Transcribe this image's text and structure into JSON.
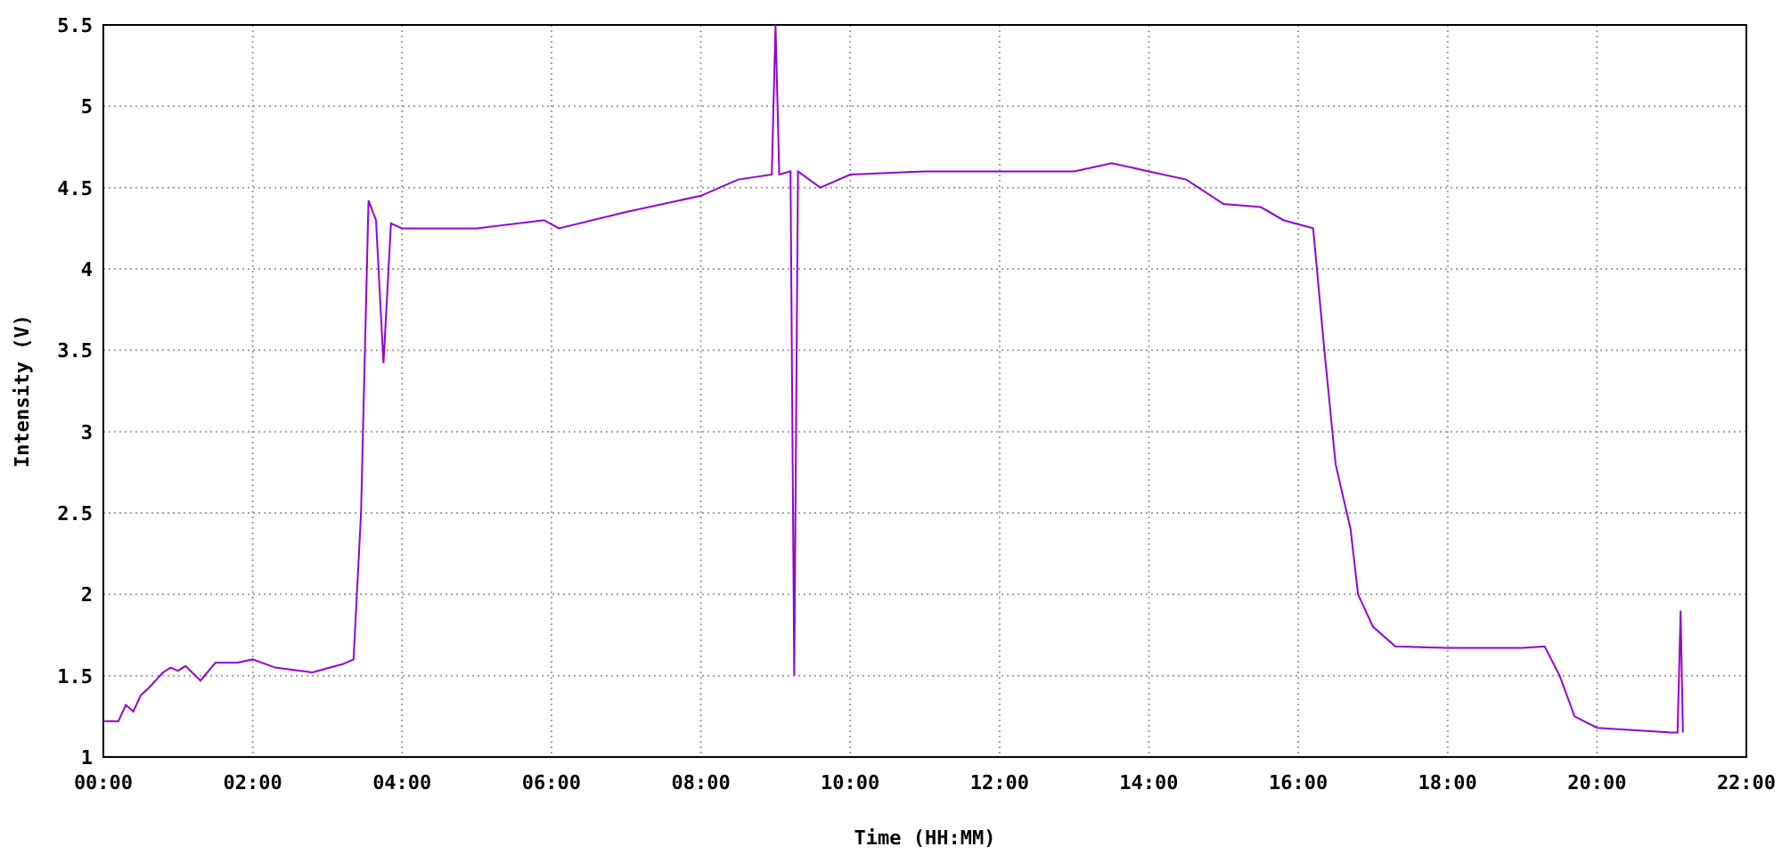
{
  "chart_data": {
    "type": "line",
    "grid": true,
    "xlabel": "Time (HH:MM)",
    "ylabel": "Intensity (V)",
    "xlim": [
      0,
      22
    ],
    "ylim": [
      1,
      5.5
    ],
    "xticks": [
      {
        "value": 0,
        "label": "00:00"
      },
      {
        "value": 2,
        "label": "02:00"
      },
      {
        "value": 4,
        "label": "04:00"
      },
      {
        "value": 6,
        "label": "06:00"
      },
      {
        "value": 8,
        "label": "08:00"
      },
      {
        "value": 10,
        "label": "10:00"
      },
      {
        "value": 12,
        "label": "12:00"
      },
      {
        "value": 14,
        "label": "14:00"
      },
      {
        "value": 16,
        "label": "16:00"
      },
      {
        "value": 18,
        "label": "18:00"
      },
      {
        "value": 20,
        "label": "20:00"
      },
      {
        "value": 22,
        "label": "22:00"
      }
    ],
    "yticks": [
      1,
      1.5,
      2,
      2.5,
      3,
      3.5,
      4,
      4.5,
      5,
      5.5
    ],
    "x": [
      0,
      0.2,
      0.3,
      0.4,
      0.5,
      0.6,
      0.8,
      0.9,
      1.0,
      1.1,
      1.3,
      1.5,
      1.8,
      2.0,
      2.3,
      2.8,
      3.2,
      3.35,
      3.45,
      3.55,
      3.65,
      3.75,
      3.85,
      4.0,
      5.0,
      5.9,
      6.1,
      7.0,
      8.0,
      8.5,
      8.95,
      9.0,
      9.05,
      9.2,
      9.25,
      9.3,
      9.6,
      10.0,
      11.0,
      12.0,
      13.0,
      13.5,
      14.0,
      14.5,
      15.0,
      15.5,
      15.8,
      16.2,
      16.35,
      16.5,
      16.7,
      16.8,
      17.0,
      17.3,
      18.0,
      19.0,
      19.3,
      19.5,
      19.7,
      20.0,
      21.0,
      21.08,
      21.12,
      21.15
    ],
    "series": [
      {
        "color": "#9400d3",
        "values": [
          1.22,
          1.22,
          1.32,
          1.28,
          1.38,
          1.42,
          1.52,
          1.55,
          1.53,
          1.56,
          1.47,
          1.58,
          1.58,
          1.6,
          1.55,
          1.52,
          1.57,
          1.6,
          2.5,
          4.42,
          4.3,
          3.42,
          4.28,
          4.25,
          4.25,
          4.3,
          4.25,
          4.35,
          4.45,
          4.55,
          4.58,
          5.5,
          4.58,
          4.6,
          1.5,
          4.6,
          4.5,
          4.58,
          4.6,
          4.6,
          4.6,
          4.65,
          4.6,
          4.55,
          4.4,
          4.38,
          4.3,
          4.25,
          3.5,
          2.8,
          2.4,
          2.0,
          1.8,
          1.68,
          1.67,
          1.67,
          1.68,
          1.5,
          1.25,
          1.18,
          1.15,
          1.15,
          1.9,
          1.15
        ]
      }
    ]
  }
}
